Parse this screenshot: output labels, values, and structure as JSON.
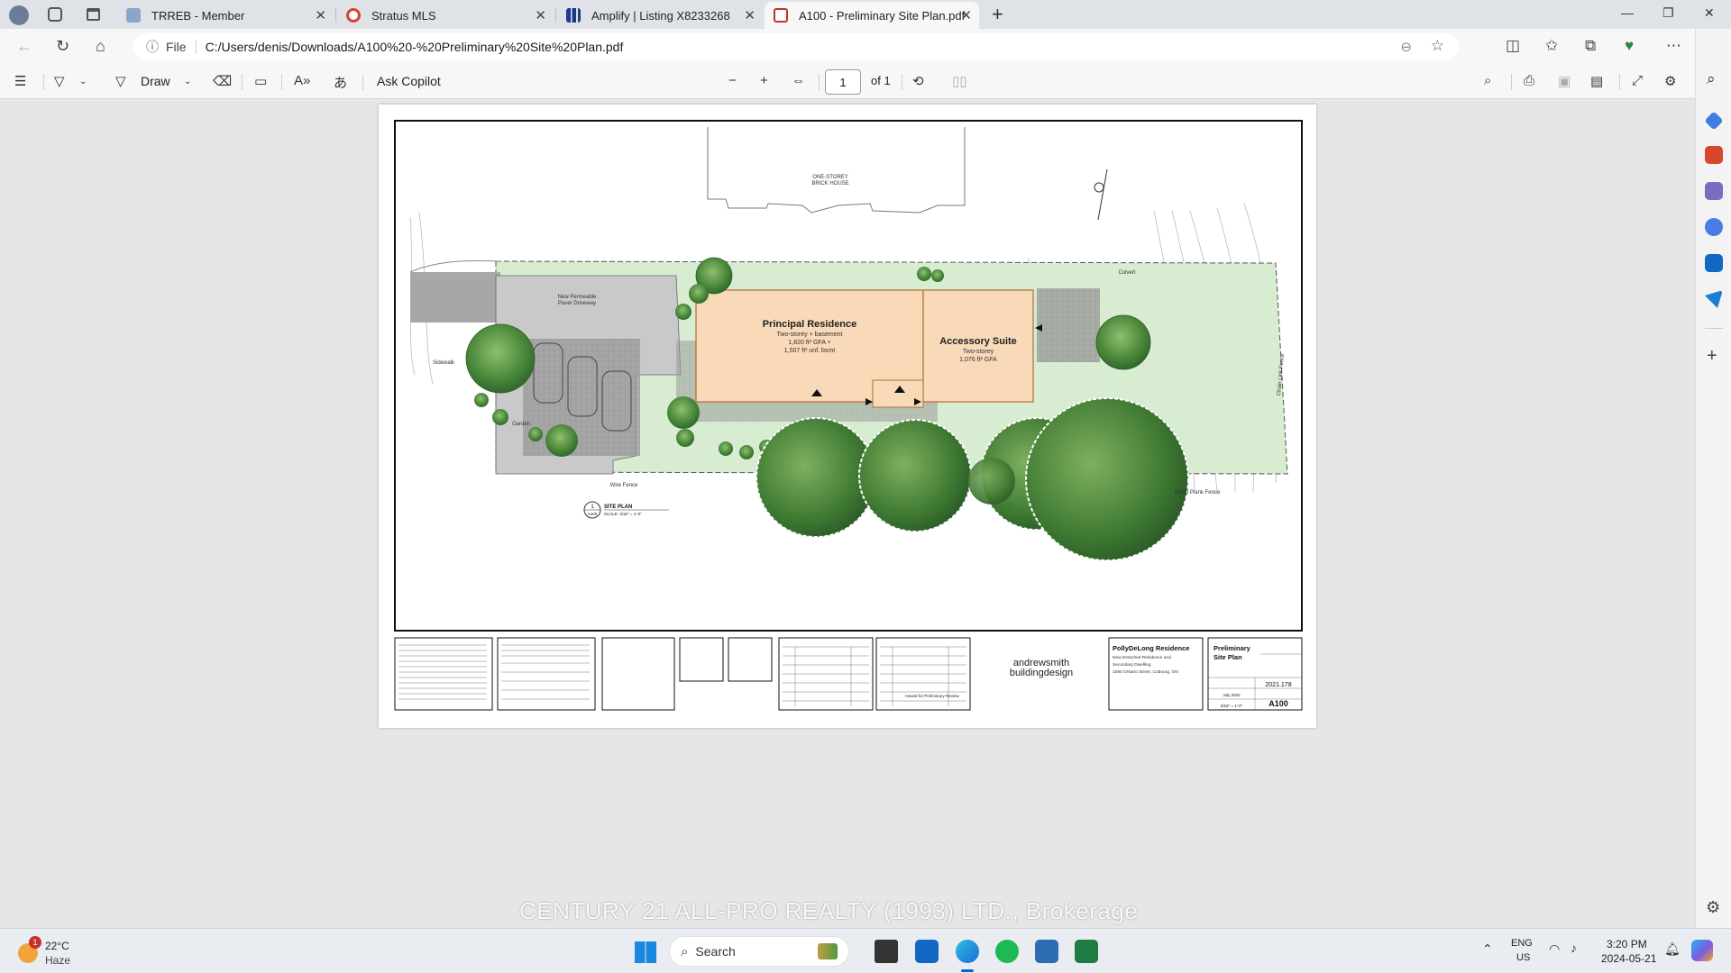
{
  "tabs": [
    {
      "label": "TRREB - Member",
      "icon": "trreb-icon"
    },
    {
      "label": "Stratus MLS",
      "icon": "stratus-icon"
    },
    {
      "label": "Amplify | Listing X8233268",
      "icon": "amplify-icon"
    },
    {
      "label": "A100 - Preliminary Site Plan.pdf",
      "icon": "pdf-icon",
      "active": true
    }
  ],
  "address": {
    "scheme_label": "File",
    "url": "C:/Users/denis/Downloads/A100%20-%20Preliminary%20Site%20Plan.pdf"
  },
  "pdf_toolbar": {
    "draw_label": "Draw",
    "ask_copilot": "Ask Copilot",
    "page_current": "1",
    "page_total": "of 1"
  },
  "drawing": {
    "house_label_1": "ONE-STOREY",
    "house_label_2": "BRICK HOUSE",
    "principal_title": "Principal Residence",
    "principal_line1": "Two-storey + basement",
    "principal_line2": "1,820 ft² GFA +",
    "principal_line3": "1,507 ft² unf. bsmt",
    "accessory_title": "Accessory Suite",
    "accessory_line1": "Two-storey",
    "accessory_line2": "1,076 ft² GFA",
    "driveway_1": "New Permeable",
    "driveway_2": "Paver Driveway",
    "sidewalk": "Sidewalk",
    "garden": "Garden",
    "wire_fence": "Wire Fence",
    "wood_fence": "Wood Plank Fence",
    "culvert": "Culvert",
    "chain_fence": "Chain Link Fence",
    "site_plan_num": "1",
    "site_plan_sheet": "A100",
    "site_plan_title": "SITE PLAN",
    "site_plan_scale": "SCALE: 3/16\" = 1'-0\"",
    "firm_line1": "andrewsmith",
    "firm_line2": "buildingdesign",
    "project_name": "PollyDeLong Residence",
    "project_line1": "New Detached Residence and",
    "project_line2": "Secondary Dwelling",
    "project_line3": "1080 Ontario Street, Cobourg, ON",
    "sheet_title_1": "Preliminary",
    "sheet_title_2": "Site Plan",
    "project_no": "2021.178",
    "sheet_no": "A100",
    "issue_label": "Issued for Preliminary Review",
    "date_label": "July 2022",
    "scale_small": "3/16\" = 1'-0\""
  },
  "watermark": "CENTURY 21 ALL-PRO REALTY (1993) LTD., Brokerage",
  "taskbar": {
    "weather_temp": "22°C",
    "weather_desc": "Haze",
    "weather_badge": "1",
    "search_label": "Search",
    "lang_1": "ENG",
    "lang_2": "US",
    "time": "3:20 PM",
    "date": "2024-05-21"
  },
  "colors": {
    "accent": "#0067c0",
    "building_fill": "#f8d9b8",
    "lawn": "#d7ecd0",
    "tree": "#4f8a3f"
  }
}
